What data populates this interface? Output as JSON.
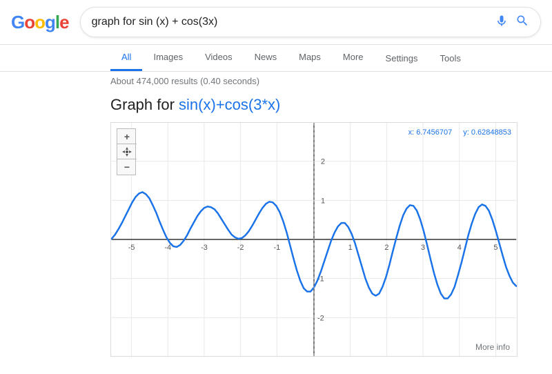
{
  "header": {
    "logo_letters": [
      {
        "letter": "G",
        "color_class": "g-blue"
      },
      {
        "letter": "o",
        "color_class": "g-red"
      },
      {
        "letter": "o",
        "color_class": "g-yellow"
      },
      {
        "letter": "g",
        "color_class": "g-blue"
      },
      {
        "letter": "l",
        "color_class": "g-green"
      },
      {
        "letter": "e",
        "color_class": "g-red"
      }
    ],
    "search_query": "graph for sin (x) + cos(3x)"
  },
  "nav": {
    "tabs": [
      {
        "label": "All",
        "active": true
      },
      {
        "label": "Images",
        "active": false
      },
      {
        "label": "Videos",
        "active": false
      },
      {
        "label": "News",
        "active": false
      },
      {
        "label": "Maps",
        "active": false
      },
      {
        "label": "More",
        "active": false
      }
    ],
    "right_tabs": [
      {
        "label": "Settings"
      },
      {
        "label": "Tools"
      }
    ]
  },
  "results": {
    "info": "About 474,000 results (0.40 seconds)",
    "heading_prefix": "Graph for ",
    "heading_formula": "sin(x)+cos(3*x)",
    "coords": {
      "x_label": "x: 6.7456707",
      "y_label": "y: 0.62848853"
    },
    "more_info_label": "More info"
  }
}
